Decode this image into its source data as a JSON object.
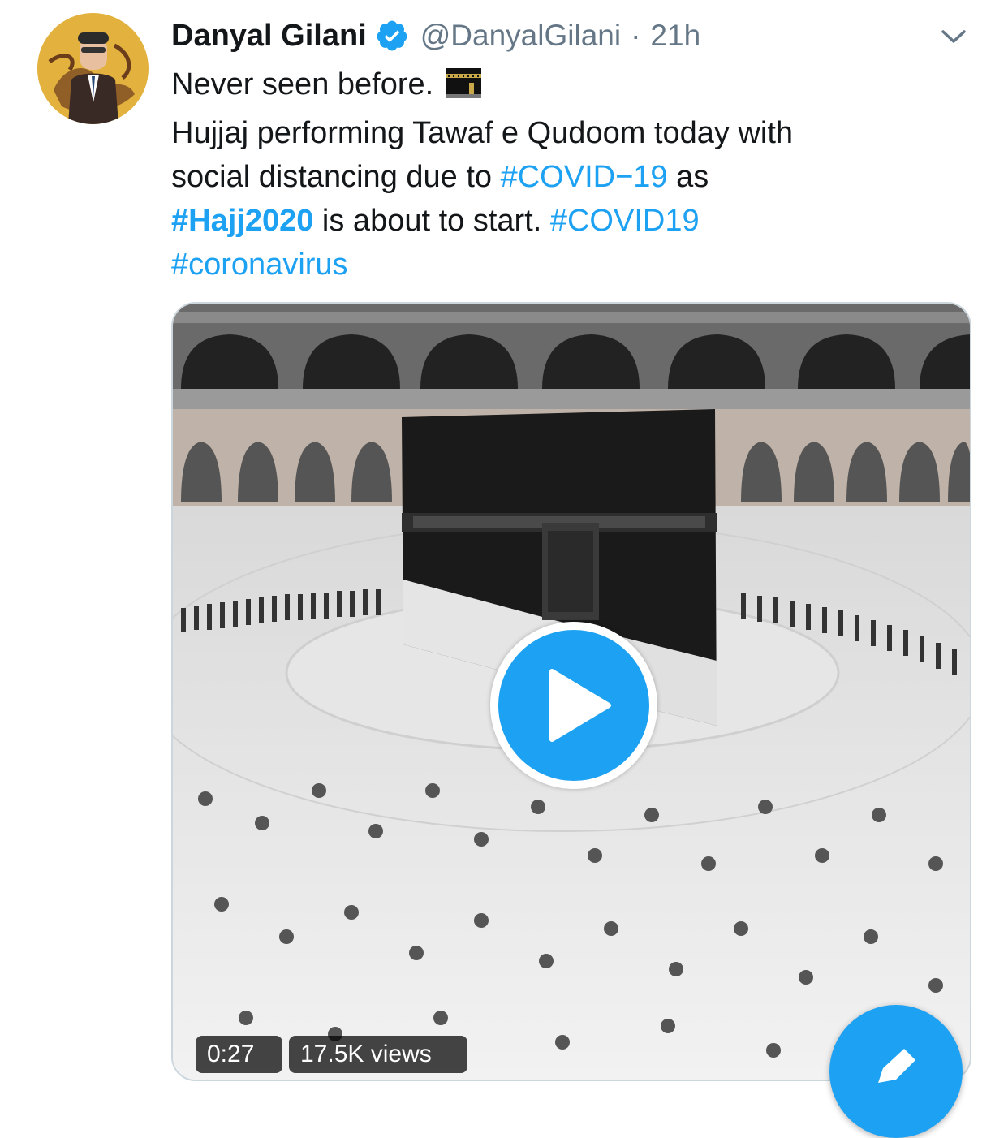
{
  "tweet": {
    "author_name": "Danyal Gilani",
    "handle": "@DanyalGilani",
    "separator": "·",
    "time": "21h",
    "text_lines": [
      [
        {
          "t": "Never seen before.",
          "kind": "plain"
        }
      ],
      [
        {
          "t": "Hujjaj performing Tawaf e Qudoom today with",
          "kind": "plain"
        }
      ],
      [
        {
          "t": "social distancing due to ",
          "kind": "plain"
        },
        {
          "t": "#COVID−19",
          "kind": "tag"
        },
        {
          "t": " as",
          "kind": "plain"
        }
      ],
      [
        {
          "t": "#Hajj2020",
          "kind": "tag-bold"
        },
        {
          "t": " is about to start. ",
          "kind": "plain"
        },
        {
          "t": "#COVID19",
          "kind": "tag"
        }
      ],
      [
        {
          "t": "#coronavirus",
          "kind": "tag"
        }
      ]
    ],
    "emoji": "kaaba-emoji"
  },
  "media": {
    "type": "video",
    "duration": "0:27",
    "views": "17.5K views"
  },
  "icons": {
    "verified": "verified-badge-icon",
    "caret": "chevron-down-icon",
    "play": "play-icon",
    "compose": "compose-tweet-icon"
  },
  "colors": {
    "accent": "#1da1f2",
    "text": "#14171a",
    "muted": "#657786"
  }
}
